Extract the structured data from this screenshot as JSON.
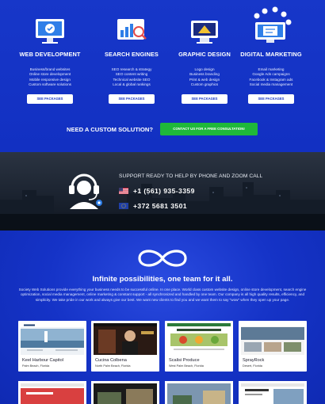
{
  "services": [
    {
      "title": "WEB DEVELOPMENT",
      "icon": "web-development-icon",
      "items": [
        "Business/brand websites",
        "Online store development",
        "Mobile responsive design",
        "Custom software solutions"
      ],
      "button": "SEE PACKAGES"
    },
    {
      "title": "SEARCH ENGINES",
      "icon": "search-engines-icon",
      "items": [
        "SEO research & strategy",
        "SEO content writing",
        "Technical website SEO",
        "Local & global rankings"
      ],
      "button": "SEE PACKAGES"
    },
    {
      "title": "GRAPHIC DESIGN",
      "icon": "graphic-design-icon",
      "items": [
        "Logo design",
        "Business branding",
        "Print & web design",
        "Custom graphics"
      ],
      "button": "SEE PACKAGES"
    },
    {
      "title": "DIGITAL MARKETING",
      "icon": "digital-marketing-icon",
      "items": [
        "Email marketing",
        "Google Ads campaigns",
        "Facebook & Instagram ads",
        "Social media management"
      ],
      "button": "SEE PACKAGES"
    }
  ],
  "custom": {
    "text": "NEED A CUSTOM SOLUTION?",
    "button": "CONTACT US FOR A FREE CONSULTATION!"
  },
  "support": {
    "title": "SUPPORT READY TO HELP BY PHONE AND ZOOM CALL",
    "phones": [
      {
        "flag": "us-flag-icon",
        "number": "+1 (561) 935-3359"
      },
      {
        "flag": "eu-flag-icon",
        "number": "+372 5681 3501"
      }
    ]
  },
  "infinite": {
    "title": "Infinite possibilities, one team for it all.",
    "text": "Society Web Solutions provide everything your business needs to be successful online. In one place. World class custom website design, online store development, search engine optimization, social media management, online marketing & constant support - all synchronized and handled by one team. Our company is all high quality results, efficiency, and simplicity. We take pride in our work and always give our best. We want new clients to find you and we want them to say \"wow\" when they open up your page."
  },
  "portfolio": [
    {
      "name": "Keel Harbour Capitol",
      "location": "Palm Beach, Florida"
    },
    {
      "name": "Cucina Colbena",
      "location": "North Palm Beach, Florida"
    },
    {
      "name": "Scalisi Produce",
      "location": "West Palm Beach, Florida"
    },
    {
      "name": "SprayRock",
      "location": "Desert, Florida"
    }
  ],
  "colors": {
    "brand_blue": "#1230c2",
    "cta_green": "#1fb83a"
  }
}
